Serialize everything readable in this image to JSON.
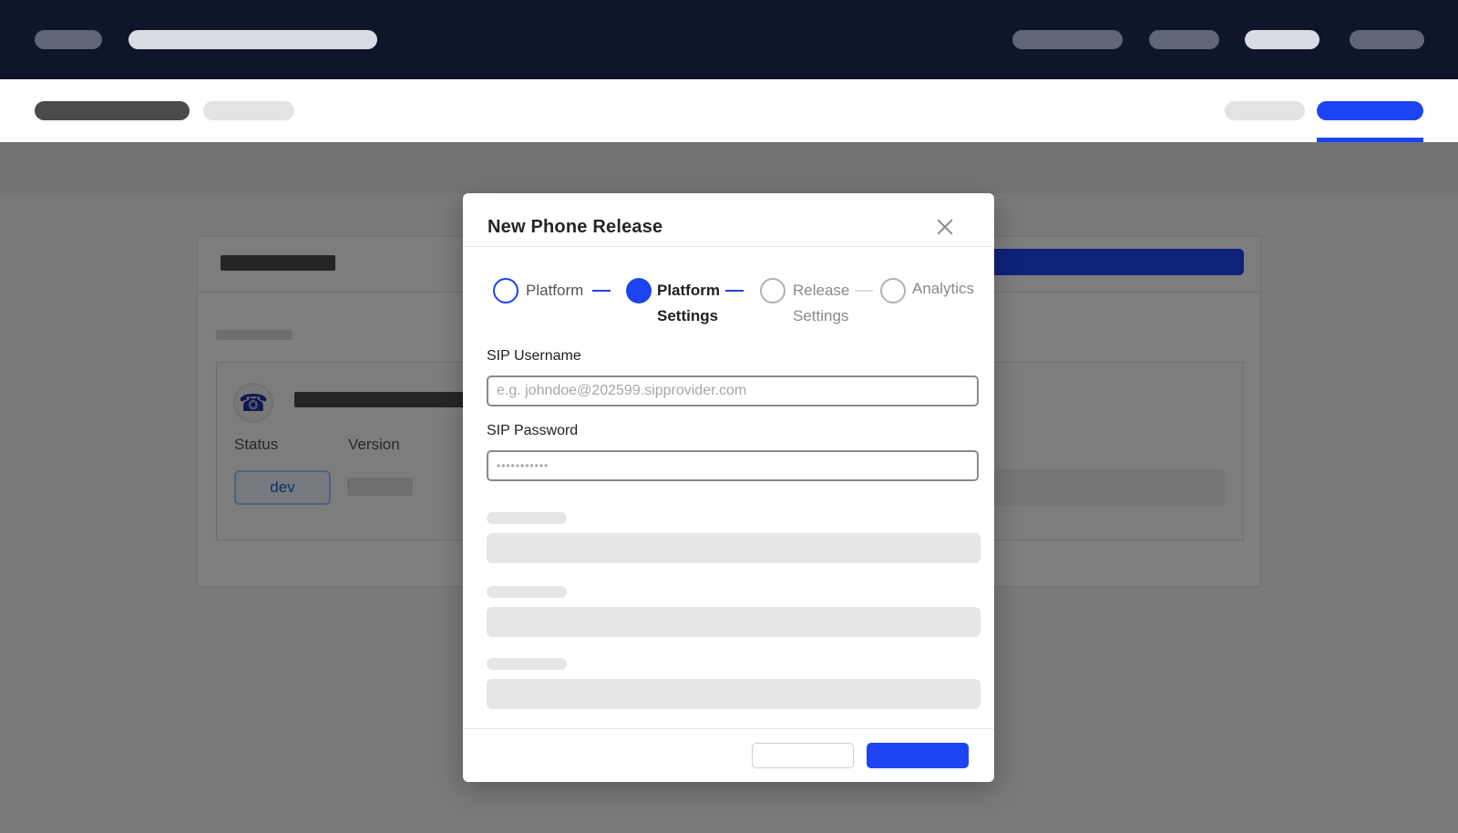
{
  "colors": {
    "nav_bg": "#0e162c",
    "accent": "#1d44f2",
    "text": "#262626",
    "muted": "#8a8a8a",
    "badge_text": "#1d5fdc"
  },
  "background_card": {
    "phone_icon": "telephone-icon",
    "phone_glyph": "☎",
    "status_label": "Status",
    "version_label": "Version",
    "status_badge": "dev"
  },
  "modal": {
    "title": "New Phone Release",
    "close_icon": "close-icon",
    "steps": [
      {
        "label_line1": "Platform",
        "label_line2": "",
        "state": "completed"
      },
      {
        "label_line1": "Platform",
        "label_line2": "Settings",
        "state": "active"
      },
      {
        "label_line1": "Release",
        "label_line2": "Settings",
        "state": "upcoming"
      },
      {
        "label_line1": "Analytics",
        "label_line2": "",
        "state": "upcoming"
      }
    ],
    "fields": {
      "username": {
        "label": "SIP Username",
        "value": "",
        "placeholder": "e.g. johndoe@202599.sipprovider.com"
      },
      "password": {
        "label": "SIP Password",
        "value": "•••••••••••",
        "placeholder": ""
      }
    }
  }
}
